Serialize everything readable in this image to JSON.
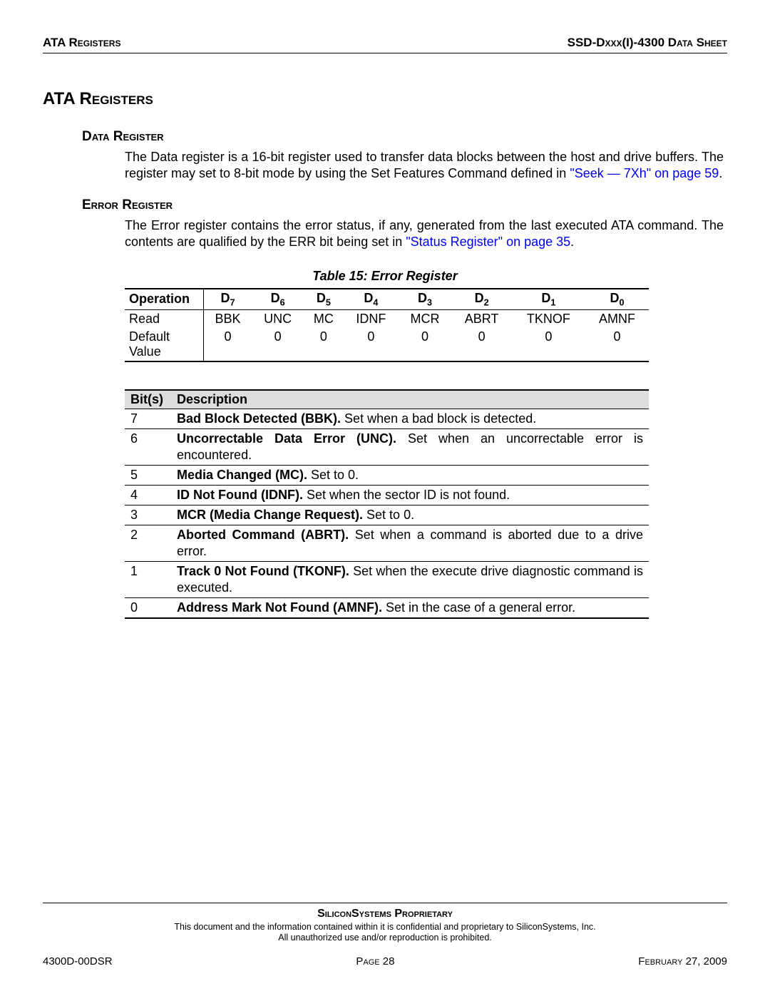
{
  "header": {
    "left": "ATA Registers",
    "right": "SSD-Dxxx(I)-4300 Data Sheet"
  },
  "title": "ATA Registers",
  "data_register": {
    "heading": "Data Register",
    "para_a": "The Data register is a 16-bit register used to transfer data blocks between the host and drive buffers. The register may set to 8-bit mode by using the Set Features Command defined in ",
    "link": "\"Seek — 7Xh\" on page 59",
    "para_b": "."
  },
  "error_register": {
    "heading": "Error Register",
    "para_a": "The Error register contains the error status, if any, generated from the last executed ATA command. The contents are qualified by the ERR bit being set in ",
    "link": "\"Status Register\" on page 35",
    "para_b": "."
  },
  "table15": {
    "caption": "Table 15:  Error Register",
    "head_op": "Operation",
    "cols": [
      "D",
      "D",
      "D",
      "D",
      "D",
      "D",
      "D",
      "D"
    ],
    "subs": [
      "7",
      "6",
      "5",
      "4",
      "3",
      "2",
      "1",
      "0"
    ],
    "rows": [
      {
        "op": "Read",
        "cells": [
          "BBK",
          "UNC",
          "MC",
          "IDNF",
          "MCR",
          "ABRT",
          "TKNOF",
          "AMNF"
        ]
      },
      {
        "op": "Default Value",
        "cells": [
          "0",
          "0",
          "0",
          "0",
          "0",
          "0",
          "0",
          "0"
        ]
      }
    ]
  },
  "bits_table": {
    "head_bits": "Bit(s)",
    "head_desc": "Description",
    "rows": [
      {
        "bit": "7",
        "bold": "Bad Block Detected (BBK).",
        "rest": " Set when a bad block is detected."
      },
      {
        "bit": "6",
        "bold": "Uncorrectable Data Error (UNC).",
        "rest": " Set when an uncorrectable error is encountered."
      },
      {
        "bit": "5",
        "bold": "Media Changed (MC).",
        "rest": " Set to 0."
      },
      {
        "bit": "4",
        "bold": "ID Not Found (IDNF).",
        "rest": " Set when the sector ID is not found."
      },
      {
        "bit": "3",
        "bold": "MCR (Media Change Request).",
        "rest": " Set to 0."
      },
      {
        "bit": "2",
        "bold": "Aborted Command (ABRT).",
        "rest": " Set when a command is aborted due to a drive error."
      },
      {
        "bit": "1",
        "bold": "Track 0 Not Found (TKONF).",
        "rest": " Set when the execute drive diagnostic command is executed."
      },
      {
        "bit": "0",
        "bold": "Address Mark Not Found (AMNF).",
        "rest": " Set in the case of a general error."
      }
    ]
  },
  "footer": {
    "proprietary": "SiliconSystems Proprietary",
    "line1": "This document and the information contained within it is confidential and proprietary to SiliconSystems, Inc.",
    "line2": "All unauthorized use and/or reproduction is prohibited.",
    "docnum": "4300D-00DSR",
    "page_label": "Page ",
    "page_num": "28",
    "date": "February 27, 2009"
  }
}
